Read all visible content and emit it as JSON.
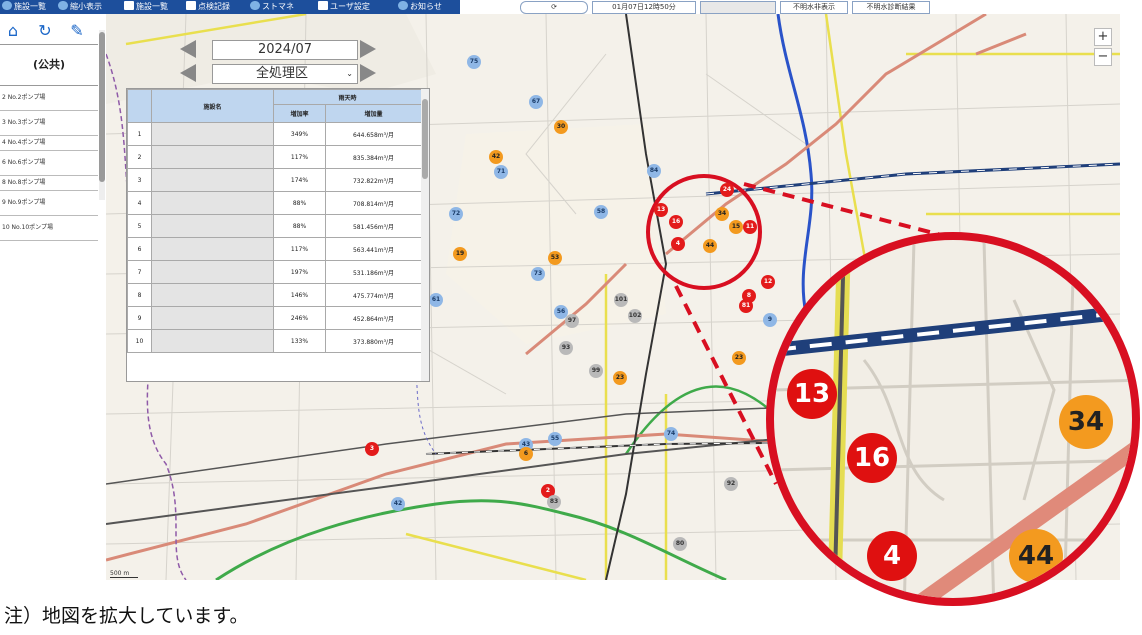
{
  "toolbar": {
    "items": [
      "施設一覧",
      "縮小表示",
      "施設一覧",
      "点検記録",
      "ストマネ",
      "ユーザ設定",
      "お知らせ"
    ],
    "datetime": "01月07日12時50分",
    "buttons": [
      "不明水非表示",
      "不明水診断結果"
    ]
  },
  "leftpanel": {
    "header": "(公共)",
    "rows": [
      "2 No.2ポンプ場",
      "3 No.3ポンプ場",
      "4 No.4ポンプ場",
      "6 No.6ポンプ場",
      "8 No.8ポンプ場",
      "9 No.9ポンプ場",
      "10 No.10ポンプ場"
    ]
  },
  "controls": {
    "date_value": "2024/07",
    "district_value": "全処理区"
  },
  "table": {
    "col_name": "施設名",
    "group_header": "雨天時",
    "col_rate": "増加率",
    "col_amount": "増加量",
    "rows": [
      {
        "no": "1",
        "rate": "349%",
        "amount": "644.658m³/月"
      },
      {
        "no": "2",
        "rate": "117%",
        "amount": "835.384m³/月"
      },
      {
        "no": "3",
        "rate": "174%",
        "amount": "732.822m³/月"
      },
      {
        "no": "4",
        "rate": "88%",
        "amount": "708.814m³/月"
      },
      {
        "no": "5",
        "rate": "88%",
        "amount": "581.456m³/月"
      },
      {
        "no": "6",
        "rate": "117%",
        "amount": "563.441m³/月"
      },
      {
        "no": "7",
        "rate": "197%",
        "amount": "531.186m³/月"
      },
      {
        "no": "8",
        "rate": "146%",
        "amount": "475.774m³/月"
      },
      {
        "no": "9",
        "rate": "246%",
        "amount": "452.864m³/月"
      },
      {
        "no": "10",
        "rate": "133%",
        "amount": "373.880m³/月"
      }
    ]
  },
  "map": {
    "zoom_in": "+",
    "zoom_out": "−",
    "scale": "500 m",
    "markers": [
      {
        "label": "75",
        "color": "blue"
      },
      {
        "label": "67",
        "color": "blue"
      },
      {
        "label": "30",
        "color": "orange"
      },
      {
        "label": "42",
        "color": "orange"
      },
      {
        "label": "71",
        "color": "blue"
      },
      {
        "label": "84",
        "color": "blue"
      },
      {
        "label": "58",
        "color": "blue"
      },
      {
        "label": "72",
        "color": "blue"
      },
      {
        "label": "19",
        "color": "orange"
      },
      {
        "label": "53",
        "color": "orange"
      },
      {
        "label": "73",
        "color": "blue"
      },
      {
        "label": "61",
        "color": "blue"
      },
      {
        "label": "56",
        "color": "blue"
      },
      {
        "label": "97",
        "color": "gray"
      },
      {
        "label": "101",
        "color": "gray"
      },
      {
        "label": "102",
        "color": "gray"
      },
      {
        "label": "93",
        "color": "gray"
      },
      {
        "label": "9",
        "color": "blue"
      },
      {
        "label": "13",
        "color": "red"
      },
      {
        "label": "16",
        "color": "red"
      },
      {
        "label": "4",
        "color": "red"
      },
      {
        "label": "24",
        "color": "red"
      },
      {
        "label": "34",
        "color": "orange"
      },
      {
        "label": "44",
        "color": "orange"
      },
      {
        "label": "15",
        "color": "orange"
      },
      {
        "label": "11",
        "color": "red"
      },
      {
        "label": "8",
        "color": "red"
      },
      {
        "label": "12",
        "color": "red"
      },
      {
        "label": "81",
        "color": "red"
      },
      {
        "label": "23",
        "color": "orange"
      },
      {
        "label": "99",
        "color": "gray"
      },
      {
        "label": "23",
        "color": "orange"
      },
      {
        "label": "43",
        "color": "blue"
      },
      {
        "label": "55",
        "color": "blue"
      },
      {
        "label": "74",
        "color": "blue"
      },
      {
        "label": "6",
        "color": "orange"
      },
      {
        "label": "3",
        "color": "red"
      },
      {
        "label": "2",
        "color": "red"
      },
      {
        "label": "80",
        "color": "gray"
      },
      {
        "label": "42",
        "color": "blue"
      },
      {
        "label": "92",
        "color": "gray"
      },
      {
        "label": "83",
        "color": "gray"
      }
    ]
  },
  "zoom_markers": [
    {
      "label": "13",
      "color": "red"
    },
    {
      "label": "16",
      "color": "red"
    },
    {
      "label": "34",
      "color": "orange"
    },
    {
      "label": "4",
      "color": "red"
    },
    {
      "label": "44",
      "color": "orange"
    }
  ],
  "colors": {
    "toolbar": "#1d4f9c",
    "highlight_circle": "#d80f21",
    "table_header": "#bfd6ef",
    "marker_red": "#e31b1b",
    "marker_orange": "#f39a1f"
  },
  "note": "注）地図を拡大しています。"
}
